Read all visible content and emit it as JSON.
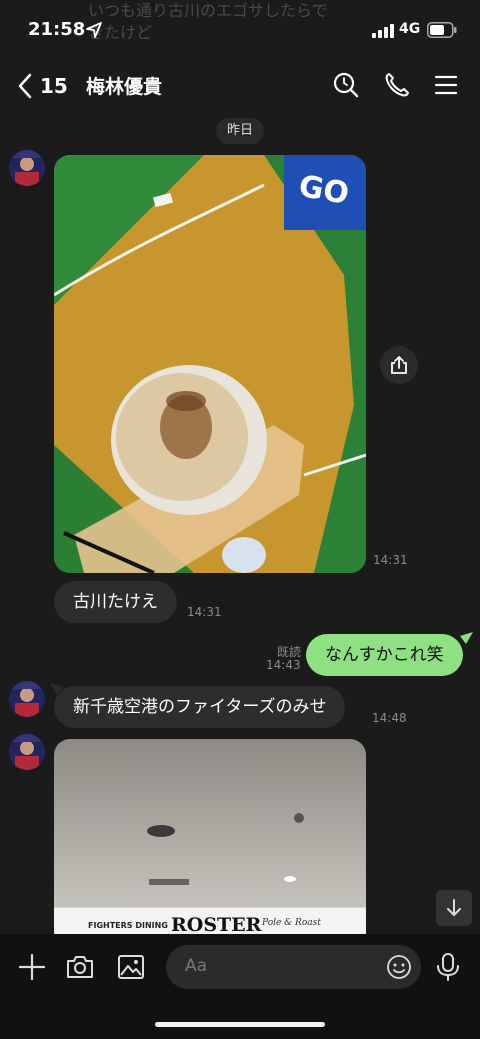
{
  "status": {
    "time": "21:58",
    "network": "4G",
    "ghost_line1": "いつも通り古川のエゴサしたらで",
    "ghost_line2": "きたけど"
  },
  "header": {
    "back_count": "15",
    "title": "梅林優貴"
  },
  "chat": {
    "date_separator": "昨日",
    "messages": [
      {
        "type": "image",
        "from": "other",
        "time": "14:31"
      },
      {
        "type": "text",
        "from": "other",
        "text": "古川たけえ",
        "time": "14:31"
      },
      {
        "type": "text",
        "from": "me",
        "text": "なんすかこれ笑",
        "time": "14:43",
        "read": "既読"
      },
      {
        "type": "text",
        "from": "other",
        "text": "新千歳空港のファイターズのみせ",
        "time": "14:48"
      },
      {
        "type": "image",
        "from": "other",
        "sign_text": "FIGHTERS DINING",
        "sign_logo": "ROSTER",
        "sign_sub": "Pole & Roast"
      }
    ]
  },
  "composer": {
    "placeholder": "Aa"
  },
  "icons": [
    "back-icon",
    "search-icon",
    "phone-icon",
    "menu-icon",
    "share-icon",
    "scroll-down-icon",
    "plus-icon",
    "camera-icon",
    "image-icon",
    "emoji-icon",
    "mic-icon",
    "location-arrow-icon",
    "signal-icon",
    "battery-icon"
  ],
  "colors": {
    "background": "#1b1b1b",
    "bubble_in": "#2d2d2d",
    "bubble_out": "#8fdf83",
    "composer_bg": "#111111"
  }
}
